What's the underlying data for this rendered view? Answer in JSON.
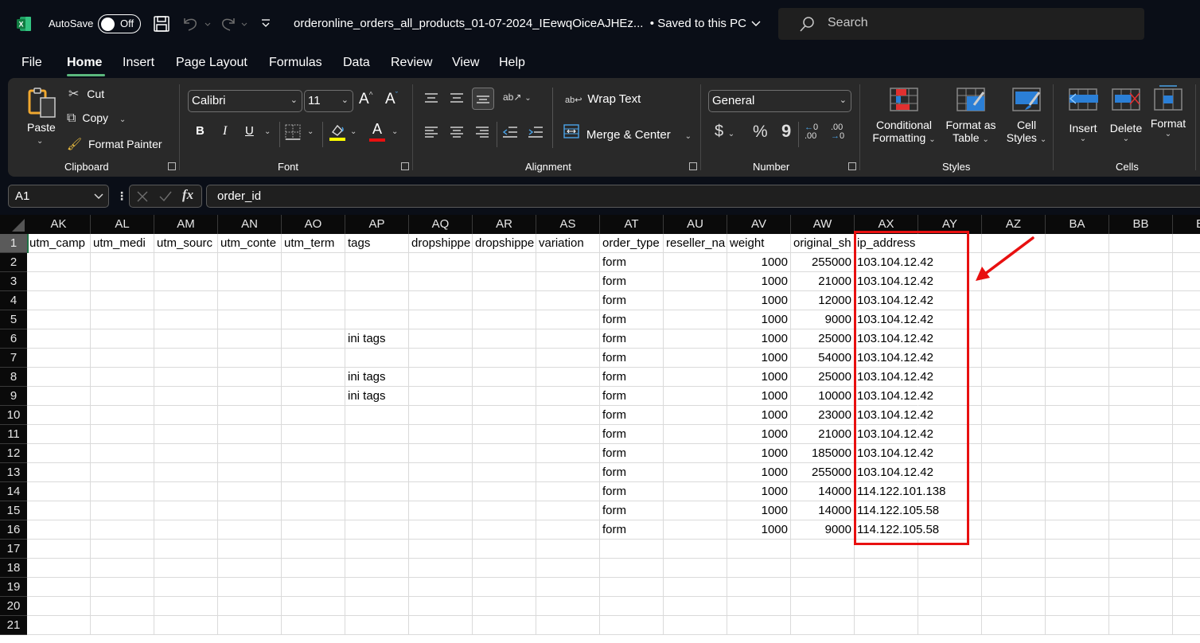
{
  "titlebar": {
    "app_icon": "excel-icon",
    "autosave_label": "AutoSave",
    "autosave_state": "Off",
    "save_icon": "save-icon",
    "undo_icon": "undo-icon",
    "redo_icon": "redo-icon",
    "customize_icon": "customize-quick-access-icon",
    "document_title": "orderonline_orders_all_products_01-07-2024_IEewqOiceAJHEz...",
    "save_status": "• Saved to this PC",
    "search_placeholder": "Search"
  },
  "menu_tabs": [
    {
      "label": "File",
      "active": false
    },
    {
      "label": "Home",
      "active": true
    },
    {
      "label": "Insert",
      "active": false
    },
    {
      "label": "Page Layout",
      "active": false
    },
    {
      "label": "Formulas",
      "active": false
    },
    {
      "label": "Data",
      "active": false
    },
    {
      "label": "Review",
      "active": false
    },
    {
      "label": "View",
      "active": false
    },
    {
      "label": "Help",
      "active": false
    }
  ],
  "ribbon": {
    "clipboard": {
      "label": "Clipboard",
      "paste": "Paste",
      "cut": "Cut",
      "copy": "Copy",
      "format_painter": "Format Painter"
    },
    "font": {
      "label": "Font",
      "font_name": "Calibri",
      "font_size": "11",
      "bold": "B",
      "italic": "I",
      "underline": "U",
      "fill_color": "#ffff00",
      "font_color": "#e81010"
    },
    "alignment": {
      "label": "Alignment",
      "wrap_text": "Wrap Text",
      "merge_center": "Merge & Center"
    },
    "number": {
      "label": "Number",
      "format": "General",
      "currency": "$",
      "percent": "%",
      "comma": "9"
    },
    "styles": {
      "label": "Styles",
      "conditional_formatting": [
        "Conditional",
        "Formatting"
      ],
      "format_as_table": [
        "Format as",
        "Table"
      ],
      "cell_styles": [
        "Cell",
        "Styles"
      ]
    },
    "cells": {
      "label": "Cells",
      "insert": "Insert",
      "delete": "Delete",
      "format": "Format"
    }
  },
  "formula_bar": {
    "name_box": "A1",
    "formula": "order_id",
    "fx_label": "fx"
  },
  "sheet": {
    "columns": [
      "AK",
      "AL",
      "AM",
      "AN",
      "AO",
      "AP",
      "AQ",
      "AR",
      "AS",
      "AT",
      "AU",
      "AV",
      "AW",
      "AX",
      "AY",
      "AZ",
      "BA",
      "BB",
      "BC"
    ],
    "row_numbers": [
      "1",
      "2",
      "3",
      "4",
      "5",
      "6",
      "7",
      "8",
      "9",
      "10",
      "11",
      "12",
      "13",
      "14",
      "15",
      "16",
      "17",
      "18",
      "19",
      "20",
      "21"
    ],
    "headers": {
      "AK": "utm_camp",
      "AL": "utm_medi",
      "AM": "utm_sourc",
      "AN": "utm_conte",
      "AO": "utm_term",
      "AP": "tags",
      "AQ": "dropshippe",
      "AR": "dropshippe",
      "AS": "variation",
      "AT": "order_type",
      "AU": "reseller_na",
      "AV": "weight",
      "AW": "original_sh",
      "AX": "ip_address"
    },
    "rows": [
      {
        "AP": "",
        "AT": "form",
        "AV": "1000",
        "AW": "255000",
        "AX": "103.104.12.42"
      },
      {
        "AP": "",
        "AT": "form",
        "AV": "1000",
        "AW": "21000",
        "AX": "103.104.12.42"
      },
      {
        "AP": "",
        "AT": "form",
        "AV": "1000",
        "AW": "12000",
        "AX": "103.104.12.42"
      },
      {
        "AP": "",
        "AT": "form",
        "AV": "1000",
        "AW": "9000",
        "AX": "103.104.12.42"
      },
      {
        "AP": "ini tags",
        "AT": "form",
        "AV": "1000",
        "AW": "25000",
        "AX": "103.104.12.42"
      },
      {
        "AP": "",
        "AT": "form",
        "AV": "1000",
        "AW": "54000",
        "AX": "103.104.12.42"
      },
      {
        "AP": "ini tags",
        "AT": "form",
        "AV": "1000",
        "AW": "25000",
        "AX": "103.104.12.42"
      },
      {
        "AP": "ini tags",
        "AT": "form",
        "AV": "1000",
        "AW": "10000",
        "AX": "103.104.12.42"
      },
      {
        "AP": "",
        "AT": "form",
        "AV": "1000",
        "AW": "23000",
        "AX": "103.104.12.42"
      },
      {
        "AP": "",
        "AT": "form",
        "AV": "1000",
        "AW": "21000",
        "AX": "103.104.12.42"
      },
      {
        "AP": "",
        "AT": "form",
        "AV": "1000",
        "AW": "185000",
        "AX": "103.104.12.42"
      },
      {
        "AP": "",
        "AT": "form",
        "AV": "1000",
        "AW": "255000",
        "AX": "103.104.12.42"
      },
      {
        "AP": "",
        "AT": "form",
        "AV": "1000",
        "AW": "14000",
        "AX": "114.122.101.138"
      },
      {
        "AP": "",
        "AT": "form",
        "AV": "1000",
        "AW": "14000",
        "AX": "114.122.105.58"
      },
      {
        "AP": "",
        "AT": "form",
        "AV": "1000",
        "AW": "9000",
        "AX": "114.122.105.58"
      }
    ]
  },
  "annotation": {
    "highlight_color": "#e81010",
    "highlight_target": "ip_address column",
    "arrow": "red-arrow"
  }
}
